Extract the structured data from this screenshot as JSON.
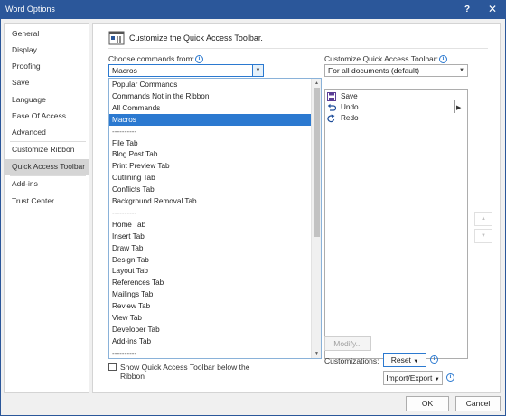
{
  "window": {
    "title": "Word Options",
    "help_glyph": "?",
    "close_glyph": "✕"
  },
  "sidebar": {
    "items": [
      {
        "label": "General"
      },
      {
        "label": "Display"
      },
      {
        "label": "Proofing"
      },
      {
        "label": "Save"
      },
      {
        "label": "Language"
      },
      {
        "label": "Ease Of Access"
      },
      {
        "label": "Advanced"
      },
      {
        "label": "Customize Ribbon"
      },
      {
        "label": "Quick Access Toolbar",
        "selected": true
      },
      {
        "label": "Add-ins"
      },
      {
        "label": "Trust Center"
      }
    ]
  },
  "header": {
    "title": "Customize the Quick Access Toolbar."
  },
  "commands": {
    "label": "Choose commands from:",
    "selected": "Macros",
    "options": [
      "Popular Commands",
      "Commands Not in the Ribbon",
      "All Commands",
      "Macros",
      "----------",
      "File Tab",
      "Blog Post Tab",
      "Print Preview Tab",
      "Outlining Tab",
      "Conflicts Tab",
      "Background Removal Tab",
      "----------",
      "Home Tab",
      "Insert Tab",
      "Draw Tab",
      "Design Tab",
      "Layout Tab",
      "References Tab",
      "Mailings Tab",
      "Review Tab",
      "View Tab",
      "Developer Tab",
      "Add-ins Tab",
      "----------"
    ],
    "selected_index": 3
  },
  "qat": {
    "label": "Customize Quick Access Toolbar:",
    "selected": "For all documents (default)",
    "items": [
      {
        "label": "Save",
        "icon": "save-icon"
      },
      {
        "label": "Undo",
        "icon": "undo-icon"
      },
      {
        "label": "Redo",
        "icon": "redo-icon"
      }
    ]
  },
  "controls": {
    "modify_label": "Modify...",
    "customizations_label": "Customizations:",
    "reset_label": "Reset",
    "import_export_label": "Import/Export",
    "show_below_label_line1": "Show Quick Access Toolbar below the",
    "show_below_label_line2": "Ribbon",
    "show_below_checked": false,
    "move_up_glyph": "▲",
    "move_down_glyph": "▼"
  },
  "footer": {
    "ok_label": "OK",
    "cancel_label": "Cancel"
  },
  "colors": {
    "title_bar": "#2b579a",
    "selection": "#2b79d0",
    "nav_selected": "#d5d5d5"
  }
}
